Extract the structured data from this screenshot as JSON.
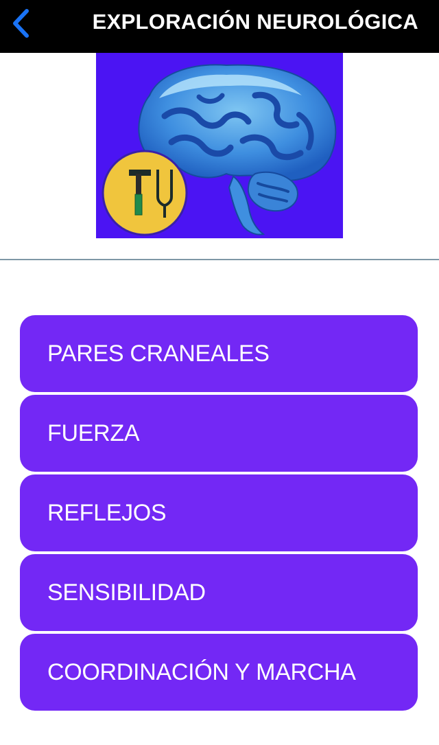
{
  "header": {
    "title": "EXPLORACIÓN NEUROLÓGICA",
    "back_icon": "chevron-left-icon",
    "background": "#000000",
    "accent": "#1a73f5"
  },
  "logo": {
    "icon": "brain-reflex-hammer-tuning-fork-logo",
    "background": "#4b14f3"
  },
  "menu": {
    "color": "#7328f5",
    "items": [
      {
        "label": "PARES CRANEALES"
      },
      {
        "label": "FUERZA"
      },
      {
        "label": "REFLEJOS"
      },
      {
        "label": "SENSIBILIDAD"
      },
      {
        "label": "COORDINACIÓN Y MARCHA"
      }
    ]
  }
}
